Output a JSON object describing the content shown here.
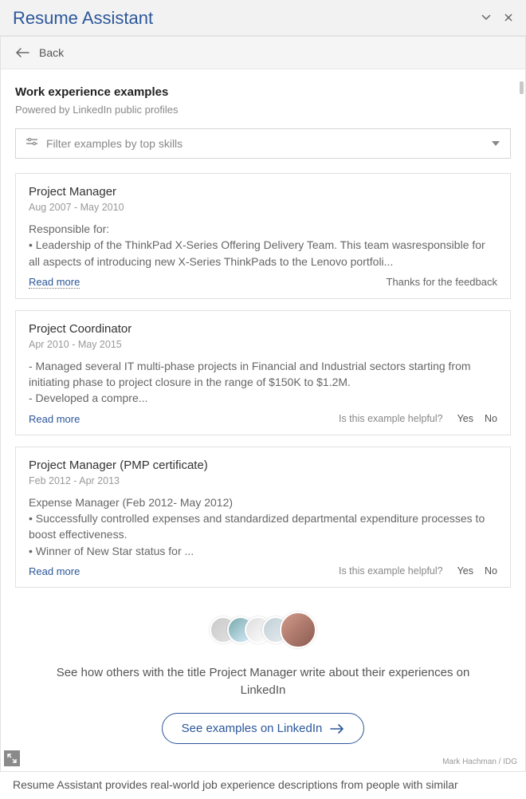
{
  "titlebar": {
    "title": "Resume Assistant"
  },
  "back": {
    "label": "Back"
  },
  "section": {
    "title": "Work experience examples",
    "subtitle": "Powered by LinkedIn public profiles"
  },
  "filter": {
    "placeholder": "Filter examples by top skills"
  },
  "examples": [
    {
      "title": "Project Manager",
      "dates": "Aug 2007 - May 2010",
      "body": "Responsible for:\n• Leadership of the ThinkPad X-Series Offering Delivery Team. This team wasresponsible for all aspects of introducing new X-Series ThinkPads to the Lenovo portfoli...",
      "read_more": "Read more",
      "feedback_mode": "thanks",
      "thanks_text": "Thanks for the feedback"
    },
    {
      "title": "Project Coordinator",
      "dates": "Apr 2010 - May 2015",
      "body": "- Managed several IT multi-phase projects in Financial and Industrial sectors starting from initiating phase to project closure in the range of $150K to $1.2M.\n- Developed a compre...",
      "read_more": "Read more",
      "feedback_mode": "ask",
      "question": "Is this example helpful?",
      "yes": "Yes",
      "no": "No"
    },
    {
      "title": "Project Manager (PMP certificate)",
      "dates": "Feb 2012 - Apr 2013",
      "body": "Expense Manager (Feb 2012- May 2012)\n• Successfully controlled expenses and standardized departmental expenditure processes to boost effectiveness.\n• Winner of New Star status for ...",
      "read_more": "Read more",
      "feedback_mode": "ask",
      "question": "Is this example helpful?",
      "yes": "Yes",
      "no": "No"
    }
  ],
  "promo": {
    "text": "See how others with the title Project Manager write about their experiences on LinkedIn",
    "cta": "See examples on LinkedIn"
  },
  "credit": "Mark Hachman / IDG",
  "caption": "Resume Assistant provides real-world job experience descriptions from people with similar"
}
